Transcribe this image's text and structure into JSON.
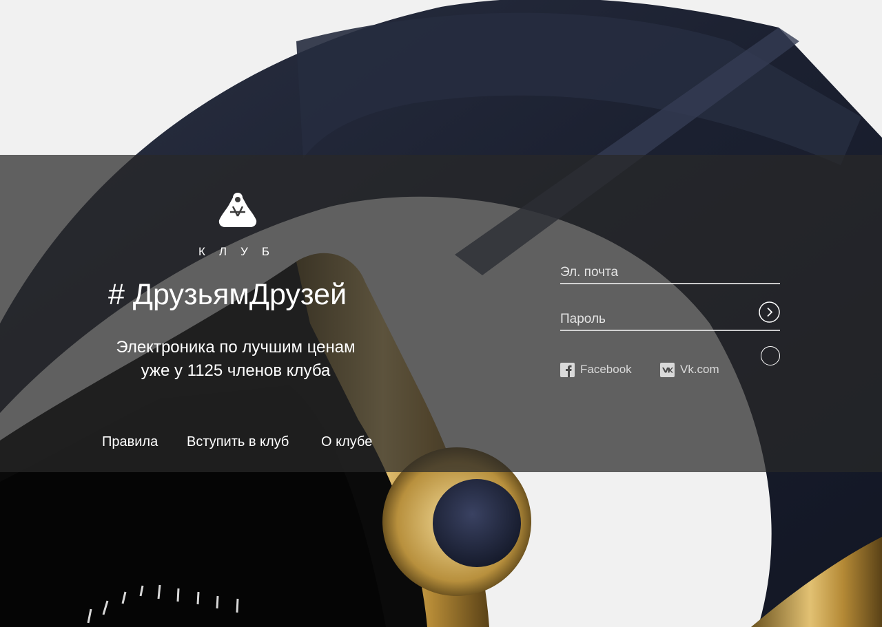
{
  "brand": {
    "logo": "hands-triangle-logo",
    "name": "КЛУБ"
  },
  "hero": {
    "hashtag": "# ДрузьямДрузей",
    "tagline_line1": "Электроника по лучшим ценам",
    "tagline_line2": "уже у 1125 членов клуба"
  },
  "nav": {
    "rules": "Правила",
    "join": "Вступить в клуб",
    "about": "О клубе"
  },
  "login": {
    "email_placeholder": "Эл. почта",
    "email_value": "",
    "password_placeholder": "Пароль",
    "password_value": "",
    "submit_icon": "chevron-right-circle-icon"
  },
  "social": {
    "facebook_icon": "facebook-icon",
    "facebook_label": "Facebook",
    "vk_icon": "vk-icon",
    "vk_label": "Vk.com"
  },
  "colors": {
    "band_overlay": "#282828",
    "text": "#ffffff",
    "strap": "#1c2131",
    "gold": "#c9a24a",
    "background": "#f1f1f1"
  }
}
